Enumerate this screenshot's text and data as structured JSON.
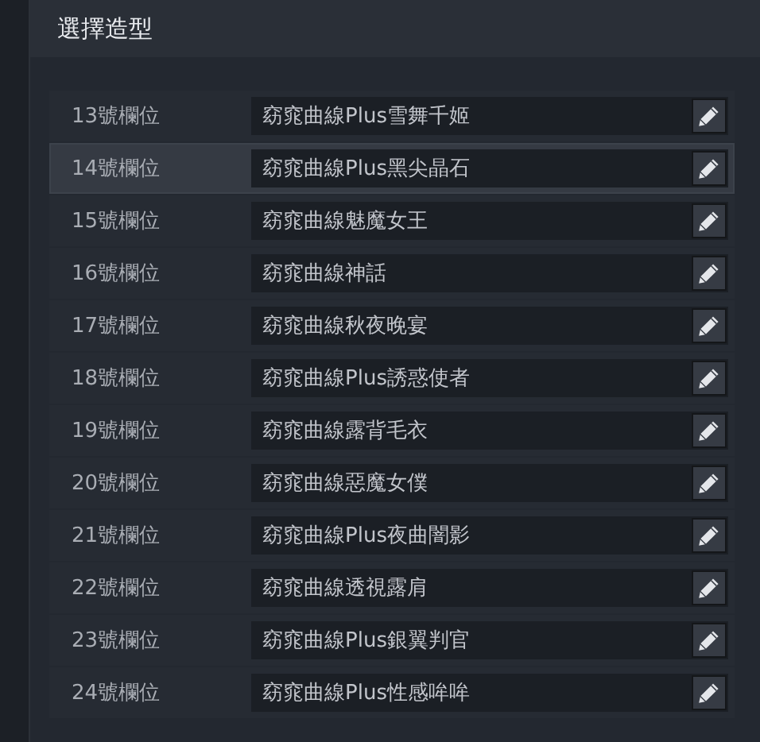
{
  "panel": {
    "title": "選擇造型"
  },
  "slots": [
    {
      "label": "13號欄位",
      "value": "窈窕曲線Plus雪舞千姬",
      "selected": false
    },
    {
      "label": "14號欄位",
      "value": "窈窕曲線Plus黑尖晶石",
      "selected": true
    },
    {
      "label": "15號欄位",
      "value": "窈窕曲線魅魔女王",
      "selected": false
    },
    {
      "label": "16號欄位",
      "value": "窈窕曲線神話",
      "selected": false
    },
    {
      "label": "17號欄位",
      "value": "窈窕曲線秋夜晚宴",
      "selected": false
    },
    {
      "label": "18號欄位",
      "value": "窈窕曲線Plus誘惑使者",
      "selected": false
    },
    {
      "label": "19號欄位",
      "value": "窈窕曲線露背毛衣",
      "selected": false
    },
    {
      "label": "20號欄位",
      "value": "窈窕曲線惡魔女僕",
      "selected": false
    },
    {
      "label": "21號欄位",
      "value": "窈窕曲線Plus夜曲闇影",
      "selected": false
    },
    {
      "label": "22號欄位",
      "value": "窈窕曲線透視露肩",
      "selected": false
    },
    {
      "label": "23號欄位",
      "value": "窈窕曲線Plus銀翼判官",
      "selected": false
    },
    {
      "label": "24號欄位",
      "value": "窈窕曲線Plus性感哞哞",
      "selected": false
    }
  ]
}
